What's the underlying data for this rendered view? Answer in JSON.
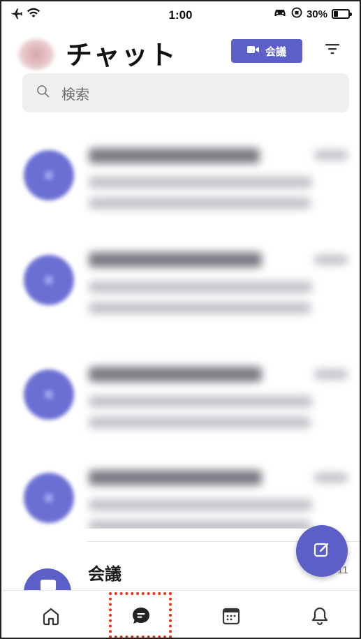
{
  "status_bar": {
    "time": "1:00",
    "battery_percent": "30%",
    "battery_level": 0.3
  },
  "header": {
    "title": "チャット",
    "meet_button_label": "会議",
    "icons": [
      "avatar",
      "video-camera-icon",
      "filter-icon"
    ]
  },
  "search": {
    "placeholder": "検索"
  },
  "chat_list": {
    "item_count_visible": 4,
    "note": ""
  },
  "meeting_row": {
    "label": "会議",
    "time": "11"
  },
  "bottom_nav": {
    "items": [
      "home-icon",
      "chat-icon",
      "calendar-icon",
      "bell-icon"
    ],
    "active": "chat-icon"
  },
  "colors": {
    "accent": "#5b5fc7",
    "highlight": "#e2331b"
  }
}
